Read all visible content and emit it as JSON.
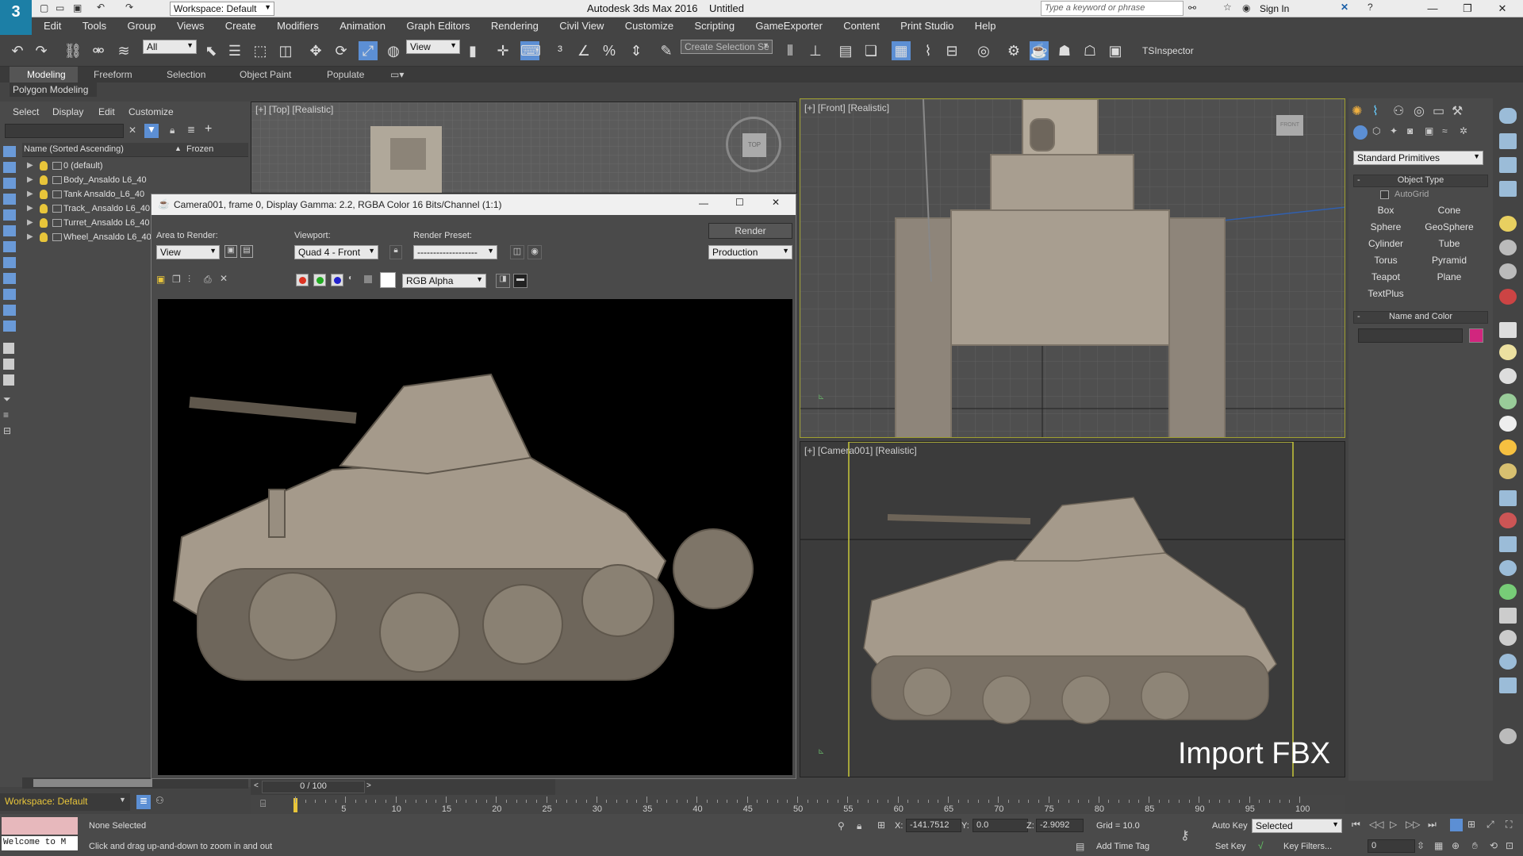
{
  "app": {
    "title": "Autodesk 3ds Max 2016",
    "file": "Untitled",
    "workspace": "Workspace: Default",
    "search_placeholder": "Type a keyword or phrase",
    "sign_in": "Sign In"
  },
  "menu": [
    "Edit",
    "Tools",
    "Group",
    "Views",
    "Create",
    "Modifiers",
    "Animation",
    "Graph Editors",
    "Rendering",
    "Civil View",
    "Customize",
    "Scripting",
    "GameExporter",
    "Content",
    "Print Studio",
    "Help"
  ],
  "toolbar": {
    "selection_filter": "All",
    "ref_coord": "View",
    "named_selection": "Create Selection Se",
    "tsinspector": "TSInspector"
  },
  "ribbon": {
    "tabs": [
      "Modeling",
      "Freeform",
      "Selection",
      "Object Paint",
      "Populate"
    ],
    "sub": "Polygon Modeling"
  },
  "scene_explorer": {
    "tabs": [
      "Select",
      "Display",
      "Edit",
      "Customize"
    ],
    "col_name": "Name (Sorted Ascending)",
    "col_frozen": "Frozen",
    "items": [
      "0 (default)",
      "Body_Ansaldo L6_40",
      "Tank Ansaldo_L6_40",
      "Track_ Ansaldo L6_40",
      "Turret_Ansaldo L6_40",
      "Wheel_Ansaldo L6_40"
    ]
  },
  "viewports": {
    "top": "[+] [Top] [Realistic]",
    "front": "[+] [Front] [Realistic]",
    "camera": "[+] [Camera001] [Realistic]",
    "overlay": "Import FBX",
    "viewcube_top": "TOP",
    "viewcube_front": "FRONT"
  },
  "render_window": {
    "title": "Camera001, frame 0, Display Gamma: 2.2, RGBA Color 16 Bits/Channel (1:1)",
    "area_label": "Area to Render:",
    "area_value": "View",
    "viewport_label": "Viewport:",
    "viewport_value": "Quad 4 - Front",
    "preset_label": "Render Preset:",
    "preset_value": "-------------------",
    "render_btn": "Render",
    "mode_value": "Production",
    "channel_value": "RGB Alpha"
  },
  "command_panel": {
    "category": "Standard Primitives",
    "object_type": "Object Type",
    "autogrid": "AutoGrid",
    "buttons": [
      "Box",
      "Cone",
      "Sphere",
      "GeoSphere",
      "Cylinder",
      "Tube",
      "Torus",
      "Pyramid",
      "Teapot",
      "Plane",
      "TextPlus"
    ],
    "name_color": "Name and Color",
    "color": "#d1267e"
  },
  "timeline": {
    "frame": "0 / 100",
    "ticks": [
      "0",
      "5",
      "10",
      "15",
      "20",
      "25",
      "30",
      "35",
      "40",
      "45",
      "50",
      "55",
      "60",
      "65",
      "70",
      "75",
      "80",
      "85",
      "90",
      "95",
      "100"
    ]
  },
  "status": {
    "workspace": "Workspace: Default",
    "maxscript": "Welcome to M",
    "selected": "None Selected",
    "prompt": "Click and drag up-and-down to zoom in and out",
    "x_label": "X:",
    "x": "-141.7512",
    "y_label": "Y:",
    "y": "0.0",
    "z_label": "Z:",
    "z": "-2.9092",
    "grid": "Grid = 10.0",
    "add_time_tag": "Add Time Tag",
    "auto_key": "Auto Key",
    "set_key": "Set Key",
    "key_mode": "Selected",
    "key_filters": "Key Filters...",
    "frame_field": "0"
  }
}
